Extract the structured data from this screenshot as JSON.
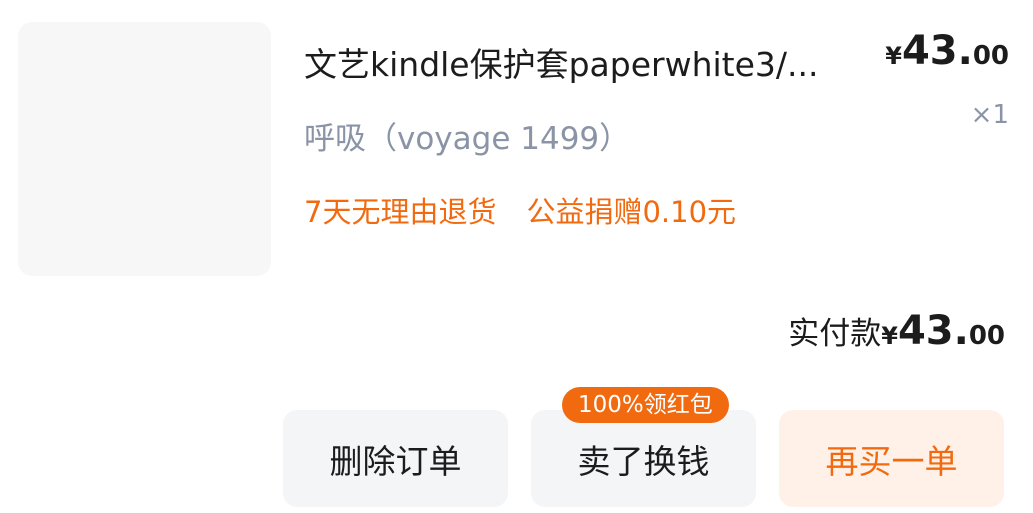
{
  "product": {
    "title": "文艺kindle保护套paperwhite3/...",
    "sku": "呼吸（voyage 1499）",
    "price": {
      "currency": "¥",
      "integer": "43.",
      "decimal": "00"
    },
    "quantity": "×1",
    "tags": [
      "7天无理由退货",
      "公益捐赠0.10元"
    ]
  },
  "payment": {
    "label": "实付款",
    "currency": "¥",
    "integer": "43.",
    "decimal": "00"
  },
  "actions": {
    "delete_label": "删除订单",
    "sell_label": "卖了换钱",
    "sell_badge": "100%领红包",
    "rebuy_label": "再买一单"
  },
  "colors": {
    "accent": "#f26a10",
    "muted": "#8a94a6",
    "button_bg": "#f3f5f7",
    "accent_bg": "#fff1e7"
  }
}
